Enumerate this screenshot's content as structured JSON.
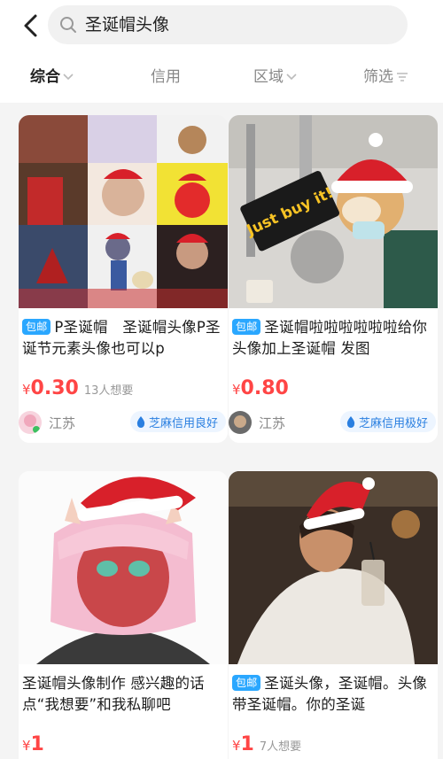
{
  "search": {
    "query": "圣诞帽头像"
  },
  "filters": [
    {
      "label": "综合",
      "active": true
    },
    {
      "label": "信用",
      "active": false
    },
    {
      "label": "区域",
      "active": false
    },
    {
      "label": "筛选",
      "active": false
    }
  ],
  "items": [
    {
      "badge": "包邮",
      "title": "P圣诞帽　圣诞帽头像P圣诞节元素头像也可以p",
      "price_symbol": "¥",
      "price": "0.30",
      "want": "13人想要",
      "location": "江苏",
      "credit": "芝麻信用良好"
    },
    {
      "badge": "包邮",
      "title": "圣诞帽啦啦啦啦啦啦给你头像加上圣诞帽 发图",
      "price_symbol": "¥",
      "price": "0.80",
      "want": "",
      "location": "江苏",
      "credit": "芝麻信用极好"
    },
    {
      "badge": "",
      "title": "圣诞帽头像制作 感兴趣的话点“我想要”和我私聊吧",
      "price_symbol": "¥",
      "price": "1",
      "want": ""
    },
    {
      "badge": "包邮",
      "title": "圣诞头像，圣诞帽。头像带圣诞帽。你的圣诞",
      "price_symbol": "¥",
      "price": "1",
      "want": "7人想要"
    }
  ],
  "thumb_texts": {
    "sticker": "Just buy it!"
  },
  "colors": {
    "price": "#ff4545",
    "badge": "#2aa7ff",
    "credit": "#2a7fe0",
    "hat_red": "#d8202a"
  }
}
